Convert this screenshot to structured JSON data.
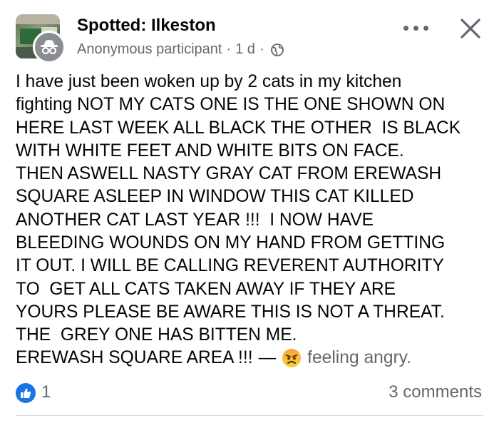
{
  "header": {
    "group_name": "Spotted: Ilkeston",
    "author": "Anonymous participant",
    "separator": "·",
    "timestamp": "1 d",
    "audience_icon": "globe-icon",
    "more_icon": "more-dots-icon",
    "close_icon": "close-icon",
    "avatar_badge_icon": "anonymous-icon"
  },
  "post": {
    "lines": [
      "I have just been woken up by 2 cats in my kitchen",
      "fighting NOT MY CATS ONE IS THE ONE SHOWN ON",
      "HERE LAST WEEK ALL BLACK THE OTHER  IS BLACK",
      "WITH WHITE FEET AND WHITE BITS ON FACE.",
      "THEN ASWELL NASTY GRAY CAT FROM EREWASH",
      "SQUARE ASLEEP IN WINDOW THIS CAT KILLED",
      "ANOTHER CAT LAST YEAR !!!  I NOW HAVE",
      "BLEEDING WOUNDS ON MY HAND FROM GETTING",
      "IT OUT. I WILL BE CALLING REVERENT AUTHORITY",
      "TO  GET ALL CATS TAKEN AWAY IF THEY ARE",
      "YOURS PLEASE BE AWARE THIS IS NOT A THREAT.",
      "THE  GREY ONE HAS BITTEN ME."
    ],
    "last_line": "EREWASH SQUARE AREA !!!",
    "dash": "—",
    "feeling_icon": "angry-face-icon",
    "feeling": "feeling angry."
  },
  "footer": {
    "like_icon": "like-icon",
    "like_count": "1",
    "comments": "3 comments"
  },
  "colors": {
    "text_primary": "#050505",
    "text_secondary": "#65676b",
    "like_blue": "#1b74e4",
    "divider": "#dadde1"
  }
}
